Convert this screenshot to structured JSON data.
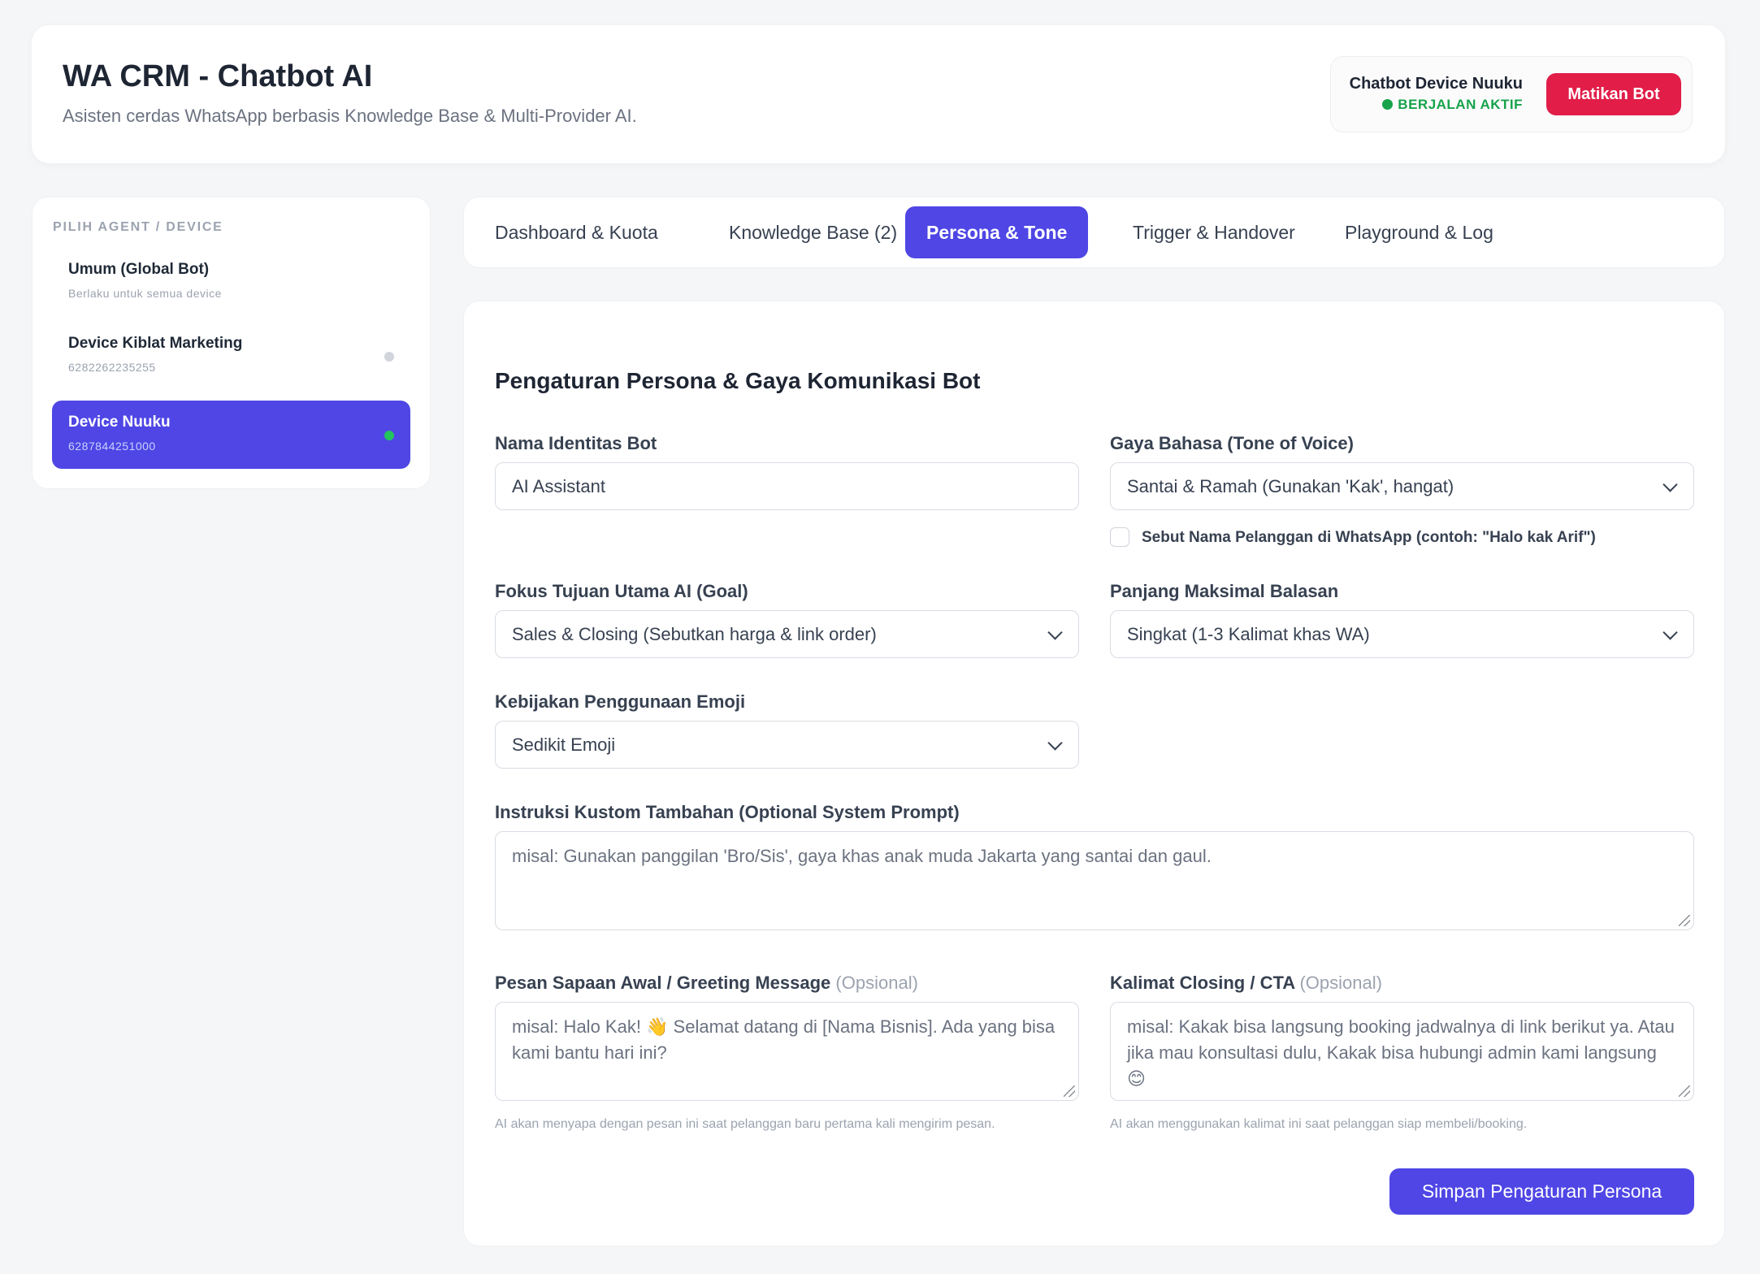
{
  "header": {
    "title": "WA CRM - Chatbot AI",
    "subtitle": "Asisten cerdas WhatsApp berbasis Knowledge Base & Multi-Provider AI.",
    "status": {
      "device_label": "Chatbot Device Nuuku",
      "state_label": "BERJALAN AKTIF",
      "state_color": "#16a34a",
      "stop_label": "Matikan Bot",
      "stop_color": "#e11d48"
    }
  },
  "sidebar": {
    "heading": "PILIH AGENT / DEVICE",
    "items": [
      {
        "name": "Umum (Global Bot)",
        "sub": "Berlaku untuk semua device",
        "active": false,
        "online": null
      },
      {
        "name": "Device Kiblat Marketing",
        "sub": "6282262235255",
        "active": false,
        "online": false
      },
      {
        "name": "Device Nuuku",
        "sub": "6287844251000",
        "active": true,
        "online": true
      }
    ]
  },
  "tabs": [
    {
      "label": "Dashboard & Kuota",
      "active": false
    },
    {
      "label": "Knowledge Base (2)",
      "active": false
    },
    {
      "label": "Persona & Tone",
      "active": true
    },
    {
      "label": "Trigger & Handover",
      "active": false
    },
    {
      "label": "Playground & Log",
      "active": false
    }
  ],
  "accent_color": "#4f46e5",
  "form": {
    "title": "Pengaturan Persona & Gaya Komunikasi Bot",
    "bot_name": {
      "label": "Nama Identitas Bot",
      "value": "AI Assistant"
    },
    "tone": {
      "label": "Gaya Bahasa (Tone of Voice)",
      "value": "Santai & Ramah (Gunakan 'Kak', hangat)"
    },
    "mention_name": {
      "label": "Sebut Nama Pelanggan di WhatsApp (contoh: \"Halo kak Arif\")",
      "checked": false
    },
    "goal": {
      "label": "Fokus Tujuan Utama AI (Goal)",
      "value": "Sales & Closing (Sebutkan harga & link order)"
    },
    "max_length": {
      "label": "Panjang Maksimal Balasan",
      "value": "Singkat (1-3 Kalimat khas WA)"
    },
    "emoji": {
      "label": "Kebijakan Penggunaan Emoji",
      "value": "Sedikit Emoji"
    },
    "custom_prompt": {
      "label": "Instruksi Kustom Tambahan (Optional System Prompt)",
      "placeholder": "misal: Gunakan panggilan 'Bro/Sis', gaya khas anak muda Jakarta yang santai dan gaul."
    },
    "greeting": {
      "label": "Pesan Sapaan Awal / Greeting Message",
      "optional": "(Opsional)",
      "placeholder": "misal: Halo Kak! 👋 Selamat datang di [Nama Bisnis]. Ada yang bisa kami bantu hari ini?",
      "help": "AI akan menyapa dengan pesan ini saat pelanggan baru pertama kali mengirim pesan."
    },
    "closing": {
      "label": "Kalimat Closing / CTA",
      "optional": "(Opsional)",
      "placeholder": "misal: Kakak bisa langsung booking jadwalnya di link berikut ya. Atau jika mau konsultasi dulu, Kakak bisa hubungi admin kami langsung 😊",
      "help": "AI akan menggunakan kalimat ini saat pelanggan siap membeli/booking."
    },
    "save_label": "Simpan Pengaturan Persona"
  }
}
